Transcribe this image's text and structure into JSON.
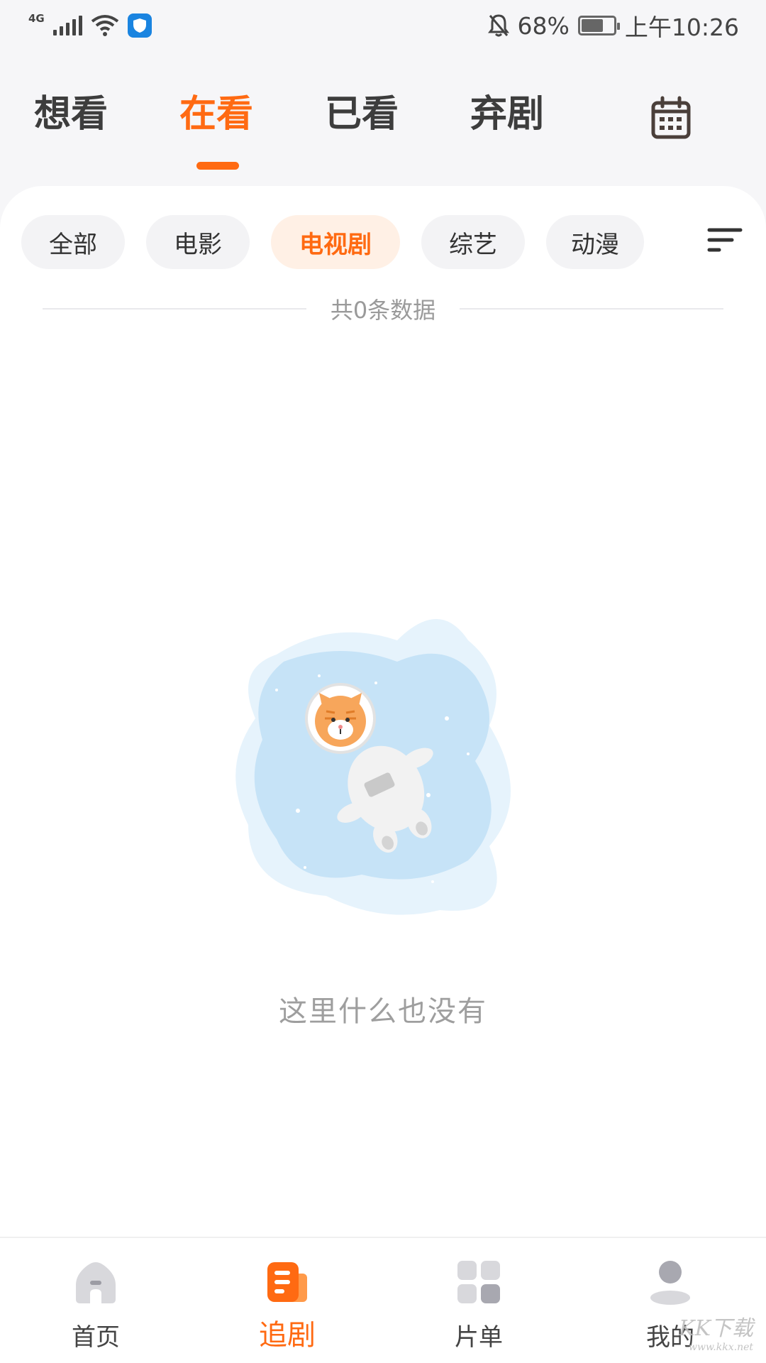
{
  "status_bar": {
    "network": "4G",
    "battery_percent": "68%",
    "battery_level": 0.68,
    "time": "上午10:26"
  },
  "top_tabs": [
    {
      "label": "想看"
    },
    {
      "label": "在看"
    },
    {
      "label": "已看"
    },
    {
      "label": "弃剧"
    }
  ],
  "active_top_tab": "在看",
  "filters": [
    {
      "label": "全部"
    },
    {
      "label": "电影"
    },
    {
      "label": "电视剧"
    },
    {
      "label": "综艺"
    },
    {
      "label": "动漫"
    }
  ],
  "active_filter": "电视剧",
  "count_text": "共0条数据",
  "empty_text": "这里什么也没有",
  "bottom_nav": [
    {
      "label": "首页",
      "icon": "home-icon"
    },
    {
      "label": "追剧",
      "icon": "follow-list-icon"
    },
    {
      "label": "片单",
      "icon": "grid-icon"
    },
    {
      "label": "我的",
      "icon": "profile-icon"
    }
  ],
  "active_nav": "追剧",
  "watermark": {
    "main": "KK下载",
    "sub": "www.kkx.net"
  },
  "colors": {
    "accent": "#ff6a12",
    "chip_active_bg": "#fff0e5",
    "chip_bg": "#f3f3f5"
  }
}
